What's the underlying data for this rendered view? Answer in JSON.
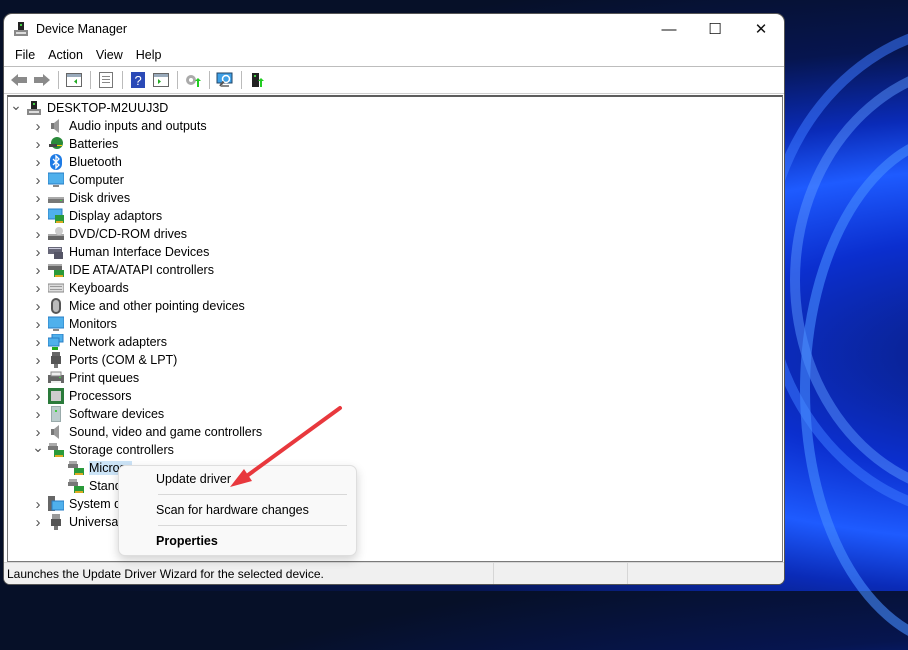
{
  "window": {
    "title": "Device Manager",
    "controls": {
      "minimize": "—",
      "maximize": "☐",
      "close": "✕"
    }
  },
  "menu": [
    "File",
    "Action",
    "View",
    "Help"
  ],
  "toolbar": {
    "buttons": [
      "back-icon",
      "forward-icon",
      "show-hide-console-tree-icon",
      "properties-icon",
      "help-icon",
      "show-action-pane-icon",
      "update-driver-icon",
      "scan-hardware-icon",
      "add-legacy-hardware-icon"
    ]
  },
  "tree": {
    "root": "DESKTOP-M2UUJ3D",
    "categories": [
      {
        "label": "Audio inputs and outputs",
        "icon": "speaker-icon",
        "expanded": false
      },
      {
        "label": "Batteries",
        "icon": "battery-icon",
        "expanded": false
      },
      {
        "label": "Bluetooth",
        "icon": "bluetooth-icon",
        "expanded": false
      },
      {
        "label": "Computer",
        "icon": "computer-icon",
        "expanded": false
      },
      {
        "label": "Disk drives",
        "icon": "disk-drive-icon",
        "expanded": false
      },
      {
        "label": "Display adaptors",
        "icon": "display-adapter-icon",
        "expanded": false
      },
      {
        "label": "DVD/CD-ROM drives",
        "icon": "dvd-drive-icon",
        "expanded": false
      },
      {
        "label": "Human Interface Devices",
        "icon": "hid-icon",
        "expanded": false
      },
      {
        "label": "IDE ATA/ATAPI controllers",
        "icon": "ide-controller-icon",
        "expanded": false
      },
      {
        "label": "Keyboards",
        "icon": "keyboard-icon",
        "expanded": false
      },
      {
        "label": "Mice and other pointing devices",
        "icon": "mouse-icon",
        "expanded": false
      },
      {
        "label": "Monitors",
        "icon": "monitor-icon",
        "expanded": false
      },
      {
        "label": "Network adapters",
        "icon": "network-adapter-icon",
        "expanded": false
      },
      {
        "label": "Ports (COM & LPT)",
        "icon": "port-icon",
        "expanded": false
      },
      {
        "label": "Print queues",
        "icon": "printer-icon",
        "expanded": false
      },
      {
        "label": "Processors",
        "icon": "processor-icon",
        "expanded": false
      },
      {
        "label": "Software devices",
        "icon": "software-device-icon",
        "expanded": false
      },
      {
        "label": "Sound, video and game controllers",
        "icon": "speaker-icon",
        "expanded": false
      },
      {
        "label": "Storage controllers",
        "icon": "storage-controller-icon",
        "expanded": true
      },
      {
        "label": "System devices",
        "visible_label": "System d",
        "icon": "system-devices-icon",
        "expanded": false
      },
      {
        "label": "Universal Serial Bus controllers",
        "visible_label": "Universal",
        "icon": "usb-icon",
        "expanded": false
      }
    ],
    "storage_children": [
      {
        "label": "Microsoft Storage Spaces Controller",
        "visible_label": "Micros",
        "selected": true
      },
      {
        "label": "Standard NVM Express Controller",
        "visible_label": "Stand",
        "selected": false
      }
    ]
  },
  "context_menu": {
    "items": [
      "Update driver",
      "Scan for hardware changes",
      "Properties"
    ]
  },
  "status": {
    "text": "Launches the Update Driver Wizard for the selected device."
  },
  "colors": {
    "selection": "#cce4f7",
    "annotation_arrow": "#e8383d"
  }
}
